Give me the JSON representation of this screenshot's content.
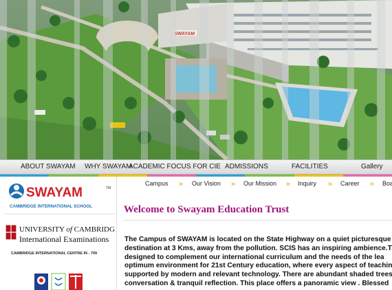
{
  "main_nav": [
    {
      "label": "ABOUT SWAYAM"
    },
    {
      "label": "WHY SWAYAM"
    },
    {
      "label": "ACADEMIC FOCUS FOR CIE"
    },
    {
      "label": "ADMISSIONS"
    },
    {
      "label": "FACILITIES"
    },
    {
      "label": "Gallery"
    }
  ],
  "nav_stripe_colors": [
    "#2aa3d5",
    "#7cc242",
    "#f2c200",
    "#e86aa6",
    "#2aa3d5",
    "#7cc242",
    "#f2c200",
    "#e86aa6"
  ],
  "hero": {
    "building_sign": "SWAYAM"
  },
  "logos": {
    "swayam_name": "SWAYAM",
    "swayam_tm": "TM",
    "swayam_tagline": "CAMBRIDGE INTERNATIONAL SCHOOL",
    "cambridge_line1_a": "UNIVERSITY",
    "cambridge_line1_b": "of",
    "cambridge_line1_c": "CAMBRIDGE",
    "cambridge_line2": "International Examinations",
    "cambridge_centre": "CAMBRIDGE INTERNATIONAL CENTRE  IN - 709"
  },
  "sub_nav": [
    {
      "label": "Campus"
    },
    {
      "label": "Our Vision"
    },
    {
      "label": "Our Mission"
    },
    {
      "label": "Inquiry"
    },
    {
      "label": "Career"
    },
    {
      "label": "Boa"
    }
  ],
  "sub_nav_separator": "»",
  "welcome_title": "Welcome to Swayam Education Trust",
  "body_lines": [
    "The Campus of SWAYAM is located on the State Highway on a quiet picturesque 8",
    "destination at 3 Kms, away from the pollution. SCIS has an inspiring ambience.The",
    "designed to complement our international curriculum and the needs of the lea",
    "optimum environment for 21st Century education, where every aspect of teachin",
    "supported by modern and relevant technology. There are abundant shaded trees",
    "conversation & tranquil reflection. This place offers a panoramic view . Blessed"
  ],
  "colors": {
    "title": "#a0147d",
    "chevron": "#e0a400",
    "swayam_blue": "#1c6fb5",
    "swayam_red": "#d21f26"
  }
}
